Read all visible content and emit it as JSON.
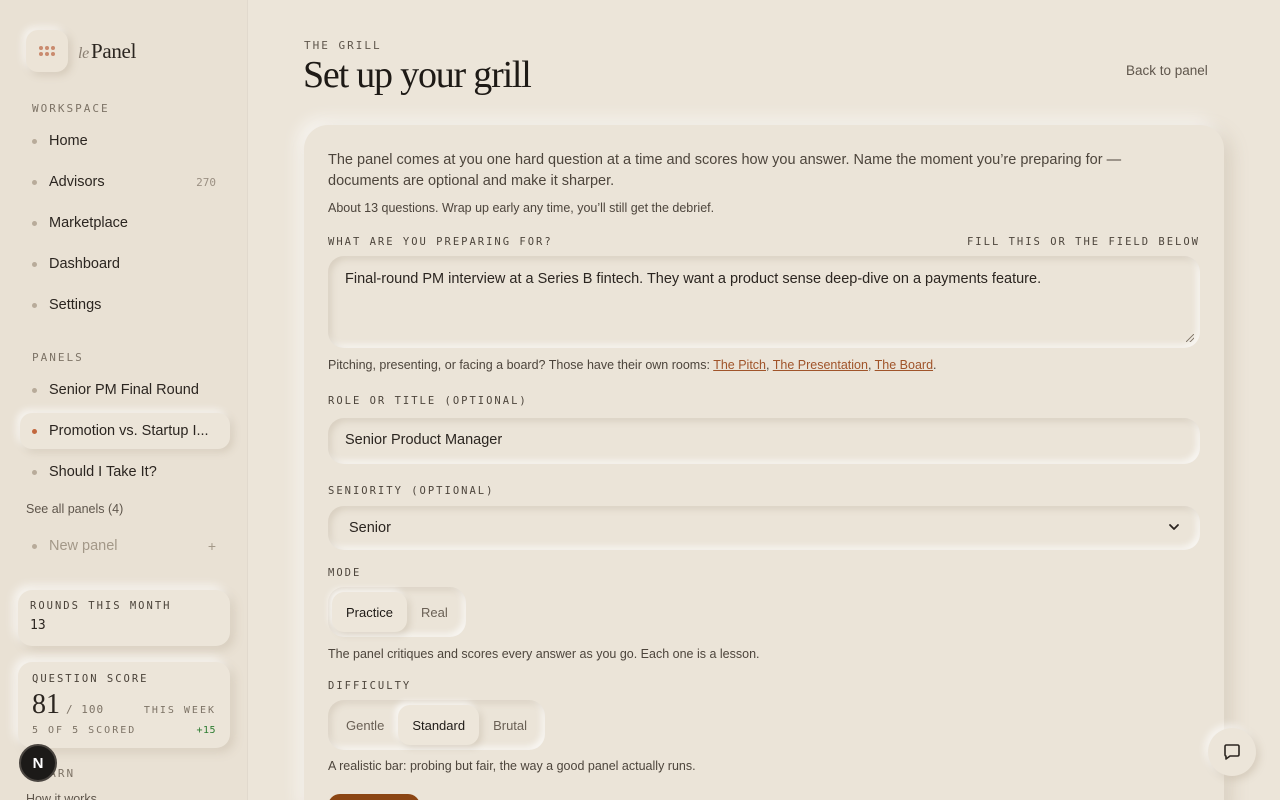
{
  "brand": {
    "prefix": "le",
    "name": "Panel",
    "menu_icon": "grid-dots-icon"
  },
  "sidebar": {
    "workspace_label": "WORKSPACE",
    "workspace_items": [
      {
        "label": "Home",
        "count": ""
      },
      {
        "label": "Advisors",
        "count": "270"
      },
      {
        "label": "Marketplace",
        "count": ""
      },
      {
        "label": "Dashboard",
        "count": ""
      },
      {
        "label": "Settings",
        "count": ""
      }
    ],
    "panels_label": "PANELS",
    "panel_items": [
      {
        "label": "Senior PM Final Round",
        "active": false
      },
      {
        "label": "Promotion vs. Startup I...",
        "active": true
      },
      {
        "label": "Should I Take It?",
        "active": false
      }
    ],
    "see_all": "See all panels (4)",
    "new_panel": "New panel",
    "new_panel_icon": "+",
    "rounds_card": {
      "label": "ROUNDS THIS MONTH",
      "value": "13"
    },
    "score_card": {
      "label": "QUESTION SCORE",
      "score": "81",
      "out_of": "/ 100",
      "period": "THIS WEEK",
      "scored": "5 OF 5 SCORED",
      "delta": "+15",
      "delta_color": "#2e7d32"
    },
    "avatar_letter": "N",
    "learn_label": "LEARN",
    "how_it_works": "How it works"
  },
  "header": {
    "eyebrow": "THE GRILL",
    "title": "Set up your grill",
    "back_link": "Back to panel"
  },
  "form": {
    "intro": "The panel comes at you one hard question at a time and scores how you answer. Name the moment you’re preparing for — documents are optional and make it sharper.",
    "sub_intro": "About 13 questions. Wrap up early any time, you’ll still get the debrief.",
    "preparing_label": "WHAT ARE YOU PREPARING FOR?",
    "preparing_hint": "FILL THIS OR THE FIELD BELOW",
    "preparing_value": "Final-round PM interview at a Series B fintech. They want a product sense deep-dive on a payments feature.",
    "rooms_text": "Pitching, presenting, or facing a board? Those have their own rooms: ",
    "rooms_links": [
      "The Pitch",
      "The Presentation",
      "The Board"
    ],
    "role_label": "ROLE OR TITLE (OPTIONAL)",
    "role_value": "Senior Product Manager",
    "seniority_label": "SENIORITY (OPTIONAL)",
    "seniority_value": "Senior",
    "mode_label": "MODE",
    "mode_options": [
      "Practice",
      "Real"
    ],
    "mode_selected": "Practice",
    "mode_desc": "The panel critiques and scores every answer as you go. Each one is a lesson.",
    "difficulty_label": "DIFFICULTY",
    "difficulty_options": [
      "Gentle",
      "Standard",
      "Brutal"
    ],
    "difficulty_selected": "Standard",
    "difficulty_desc": "A realistic bar: probing but fair, the way a good panel actually runs."
  },
  "colors": {
    "accent": "#c2673d",
    "link": "#a0542a",
    "start_button": "#8b4513",
    "background": "#ece5d9"
  }
}
